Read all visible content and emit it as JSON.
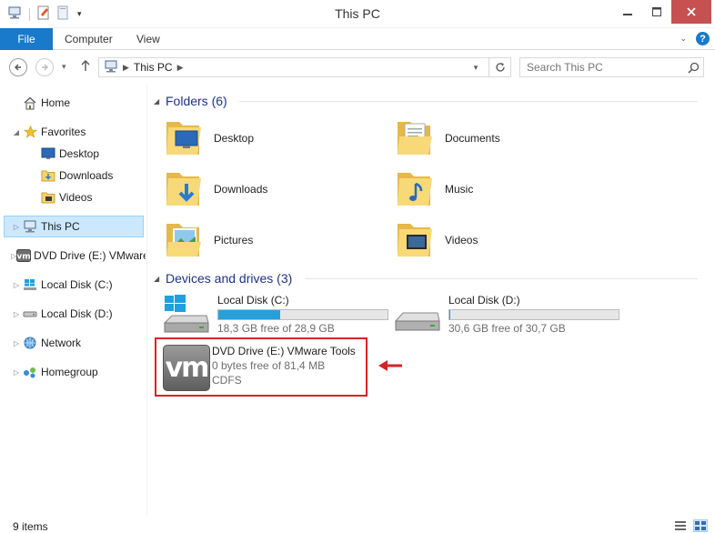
{
  "window": {
    "title": "This PC"
  },
  "ribbon": {
    "tabs": [
      "File",
      "Computer",
      "View"
    ]
  },
  "address": {
    "crumb": "This PC",
    "search_placeholder": "Search This PC"
  },
  "nav": {
    "home": "Home",
    "favorites": "Favorites",
    "desktop": "Desktop",
    "downloads": "Downloads",
    "videos": "Videos",
    "this_pc": "This PC",
    "dvd": "DVD Drive (E:) VMware Tools",
    "local_c": "Local Disk (C:)",
    "local_d": "Local Disk (D:)",
    "network": "Network",
    "homegroup": "Homegroup"
  },
  "folders": {
    "header": "Folders (6)",
    "items": [
      {
        "name": "Desktop",
        "icon": "desktop-folder-icon"
      },
      {
        "name": "Documents",
        "icon": "documents-folder-icon"
      },
      {
        "name": "Downloads",
        "icon": "downloads-folder-icon"
      },
      {
        "name": "Music",
        "icon": "music-folder-icon"
      },
      {
        "name": "Pictures",
        "icon": "pictures-folder-icon"
      },
      {
        "name": "Videos",
        "icon": "videos-folder-icon"
      }
    ]
  },
  "devices": {
    "header": "Devices and drives (3)",
    "c": {
      "name": "Local Disk (C:)",
      "free": "18,3 GB free of 28,9 GB",
      "used_fraction": 0.367
    },
    "d": {
      "name": "Local Disk (D:)",
      "free": "30,6 GB free of 30,7 GB",
      "used_fraction": 0.003
    },
    "e": {
      "name": "DVD Drive (E:) VMware Tools",
      "free": "0 bytes free of 81,4 MB",
      "fs": "CDFS",
      "logo": "vm"
    }
  },
  "status": {
    "items": "9 items"
  },
  "colors": {
    "accent": "#1979ca",
    "selection": "#cce8ff",
    "bar_fill": "#26a0da",
    "highlight": "#d92128",
    "group_title": "#1e3287"
  }
}
